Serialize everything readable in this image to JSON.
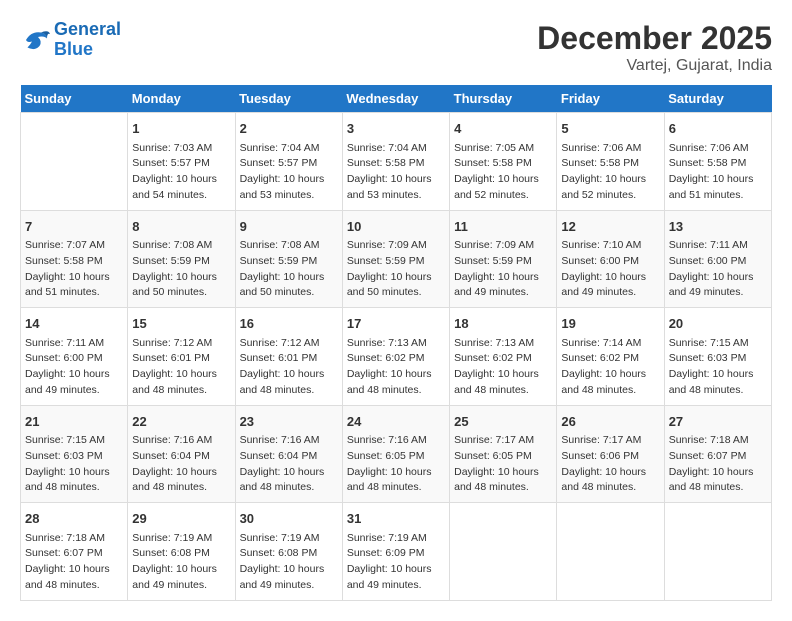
{
  "header": {
    "logo_line1": "General",
    "logo_line2": "Blue",
    "month": "December 2025",
    "location": "Vartej, Gujarat, India"
  },
  "weekdays": [
    "Sunday",
    "Monday",
    "Tuesday",
    "Wednesday",
    "Thursday",
    "Friday",
    "Saturday"
  ],
  "weeks": [
    [
      {
        "day": "",
        "info": ""
      },
      {
        "day": "1",
        "info": "Sunrise: 7:03 AM\nSunset: 5:57 PM\nDaylight: 10 hours\nand 54 minutes."
      },
      {
        "day": "2",
        "info": "Sunrise: 7:04 AM\nSunset: 5:57 PM\nDaylight: 10 hours\nand 53 minutes."
      },
      {
        "day": "3",
        "info": "Sunrise: 7:04 AM\nSunset: 5:58 PM\nDaylight: 10 hours\nand 53 minutes."
      },
      {
        "day": "4",
        "info": "Sunrise: 7:05 AM\nSunset: 5:58 PM\nDaylight: 10 hours\nand 52 minutes."
      },
      {
        "day": "5",
        "info": "Sunrise: 7:06 AM\nSunset: 5:58 PM\nDaylight: 10 hours\nand 52 minutes."
      },
      {
        "day": "6",
        "info": "Sunrise: 7:06 AM\nSunset: 5:58 PM\nDaylight: 10 hours\nand 51 minutes."
      }
    ],
    [
      {
        "day": "7",
        "info": "Sunrise: 7:07 AM\nSunset: 5:58 PM\nDaylight: 10 hours\nand 51 minutes."
      },
      {
        "day": "8",
        "info": "Sunrise: 7:08 AM\nSunset: 5:59 PM\nDaylight: 10 hours\nand 50 minutes."
      },
      {
        "day": "9",
        "info": "Sunrise: 7:08 AM\nSunset: 5:59 PM\nDaylight: 10 hours\nand 50 minutes."
      },
      {
        "day": "10",
        "info": "Sunrise: 7:09 AM\nSunset: 5:59 PM\nDaylight: 10 hours\nand 50 minutes."
      },
      {
        "day": "11",
        "info": "Sunrise: 7:09 AM\nSunset: 5:59 PM\nDaylight: 10 hours\nand 49 minutes."
      },
      {
        "day": "12",
        "info": "Sunrise: 7:10 AM\nSunset: 6:00 PM\nDaylight: 10 hours\nand 49 minutes."
      },
      {
        "day": "13",
        "info": "Sunrise: 7:11 AM\nSunset: 6:00 PM\nDaylight: 10 hours\nand 49 minutes."
      }
    ],
    [
      {
        "day": "14",
        "info": "Sunrise: 7:11 AM\nSunset: 6:00 PM\nDaylight: 10 hours\nand 49 minutes."
      },
      {
        "day": "15",
        "info": "Sunrise: 7:12 AM\nSunset: 6:01 PM\nDaylight: 10 hours\nand 48 minutes."
      },
      {
        "day": "16",
        "info": "Sunrise: 7:12 AM\nSunset: 6:01 PM\nDaylight: 10 hours\nand 48 minutes."
      },
      {
        "day": "17",
        "info": "Sunrise: 7:13 AM\nSunset: 6:02 PM\nDaylight: 10 hours\nand 48 minutes."
      },
      {
        "day": "18",
        "info": "Sunrise: 7:13 AM\nSunset: 6:02 PM\nDaylight: 10 hours\nand 48 minutes."
      },
      {
        "day": "19",
        "info": "Sunrise: 7:14 AM\nSunset: 6:02 PM\nDaylight: 10 hours\nand 48 minutes."
      },
      {
        "day": "20",
        "info": "Sunrise: 7:15 AM\nSunset: 6:03 PM\nDaylight: 10 hours\nand 48 minutes."
      }
    ],
    [
      {
        "day": "21",
        "info": "Sunrise: 7:15 AM\nSunset: 6:03 PM\nDaylight: 10 hours\nand 48 minutes."
      },
      {
        "day": "22",
        "info": "Sunrise: 7:16 AM\nSunset: 6:04 PM\nDaylight: 10 hours\nand 48 minutes."
      },
      {
        "day": "23",
        "info": "Sunrise: 7:16 AM\nSunset: 6:04 PM\nDaylight: 10 hours\nand 48 minutes."
      },
      {
        "day": "24",
        "info": "Sunrise: 7:16 AM\nSunset: 6:05 PM\nDaylight: 10 hours\nand 48 minutes."
      },
      {
        "day": "25",
        "info": "Sunrise: 7:17 AM\nSunset: 6:05 PM\nDaylight: 10 hours\nand 48 minutes."
      },
      {
        "day": "26",
        "info": "Sunrise: 7:17 AM\nSunset: 6:06 PM\nDaylight: 10 hours\nand 48 minutes."
      },
      {
        "day": "27",
        "info": "Sunrise: 7:18 AM\nSunset: 6:07 PM\nDaylight: 10 hours\nand 48 minutes."
      }
    ],
    [
      {
        "day": "28",
        "info": "Sunrise: 7:18 AM\nSunset: 6:07 PM\nDaylight: 10 hours\nand 48 minutes."
      },
      {
        "day": "29",
        "info": "Sunrise: 7:19 AM\nSunset: 6:08 PM\nDaylight: 10 hours\nand 49 minutes."
      },
      {
        "day": "30",
        "info": "Sunrise: 7:19 AM\nSunset: 6:08 PM\nDaylight: 10 hours\nand 49 minutes."
      },
      {
        "day": "31",
        "info": "Sunrise: 7:19 AM\nSunset: 6:09 PM\nDaylight: 10 hours\nand 49 minutes."
      },
      {
        "day": "",
        "info": ""
      },
      {
        "day": "",
        "info": ""
      },
      {
        "day": "",
        "info": ""
      }
    ]
  ]
}
